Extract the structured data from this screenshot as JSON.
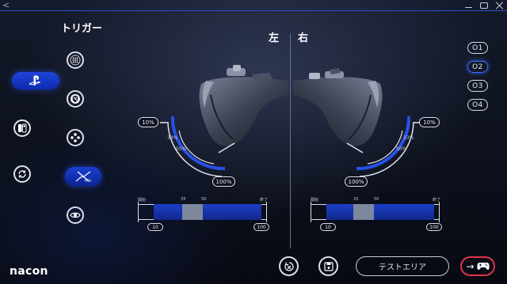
{
  "window": {
    "back_glyph": "<",
    "controls": [
      "minimize-icon",
      "maximize-icon",
      "close-icon"
    ]
  },
  "nav": {
    "items": [
      {
        "name": "playstation-icon",
        "active": true
      },
      {
        "name": "controller-layout-icon",
        "active": false
      },
      {
        "name": "refresh-icon",
        "active": false
      }
    ]
  },
  "section": {
    "title": "トリガー"
  },
  "modes": [
    {
      "name": "dots-grid-icon",
      "active": false
    },
    {
      "name": "shield-icon",
      "active": false
    },
    {
      "name": "buttons-icon",
      "active": false
    },
    {
      "name": "trigger-curve-icon",
      "active": true
    },
    {
      "name": "eye-icon",
      "active": false
    }
  ],
  "sides": {
    "left_label": "左",
    "right_label": "右"
  },
  "profiles": [
    "O1",
    "O2",
    "O3",
    "O4"
  ],
  "active_profile": "O2",
  "left_trigger": {
    "top_badge": "10%",
    "mid_33": "33%",
    "mid_50": "50%",
    "bottom_badge": "100%",
    "range": {
      "start_label": "開始",
      "end_label": "終了",
      "tick_33": "33",
      "tick_50": "50",
      "min_value": "10",
      "max_value": "100"
    }
  },
  "right_trigger": {
    "top_badge": "10%",
    "mid_33": "33%",
    "mid_50": "50%",
    "bottom_badge": "100%",
    "range": {
      "start_label": "開始",
      "end_label": "終了",
      "tick_33": "33",
      "tick_50": "50",
      "min_value": "10",
      "max_value": "100"
    }
  },
  "footer": {
    "logo": "nacon",
    "test_area_label": "テストエリア",
    "next_arrow": "→"
  },
  "colors": {
    "accent": "#1f45d8",
    "accent_glow": "#3a6cff",
    "next_border": "#e0314a",
    "deadzone": "#7d889f"
  }
}
